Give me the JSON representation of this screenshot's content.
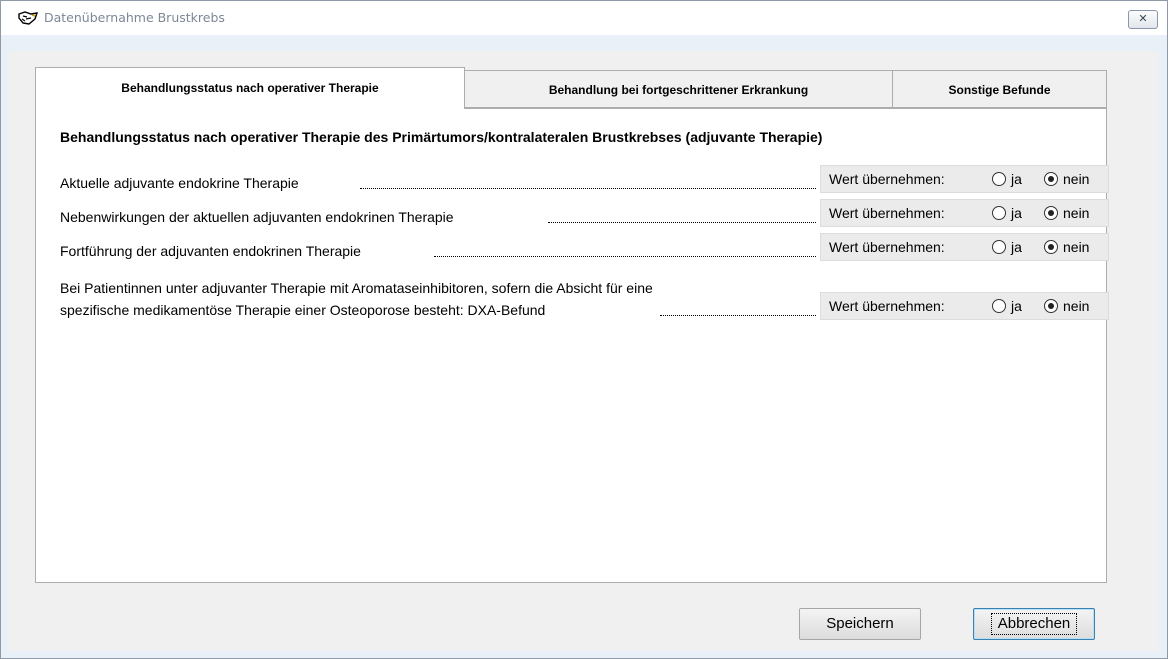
{
  "window": {
    "title": "Datenübernahme Brustkrebs",
    "close_glyph": "✕"
  },
  "tabs": [
    {
      "label": "Behandlungsstatus nach operativer Therapie",
      "active": true
    },
    {
      "label": "Behandlung bei fortgeschrittener Erkrankung",
      "active": false
    },
    {
      "label": "Sonstige Befunde",
      "active": false
    }
  ],
  "panel": {
    "section_title": "Behandlungsstatus nach operativer Therapie des Primärtumors/kontralateralen Brustkrebses (adjuvante Therapie)",
    "rows": [
      {
        "label": "Aktuelle adjuvante endokrine Therapie",
        "selected": "nein"
      },
      {
        "label": "Nebenwirkungen der aktuellen adjuvanten endokrinen Therapie",
        "selected": "nein"
      },
      {
        "label": "Fortführung der adjuvanten endokrinen Therapie",
        "selected": "nein"
      },
      {
        "label_line1": "Bei Patientinnen unter adjuvanter Therapie mit Aromataseinhibitoren, sofern die Absicht für eine",
        "label_line2": "spezifische medikamentöse Therapie einer Osteoporose besteht: DXA-Befund",
        "selected": "nein"
      }
    ],
    "option_label": "Wert übernehmen:",
    "option_yes": "ja",
    "option_no": "nein"
  },
  "buttons": {
    "save": "Speichern",
    "cancel": "Abbrechen"
  }
}
